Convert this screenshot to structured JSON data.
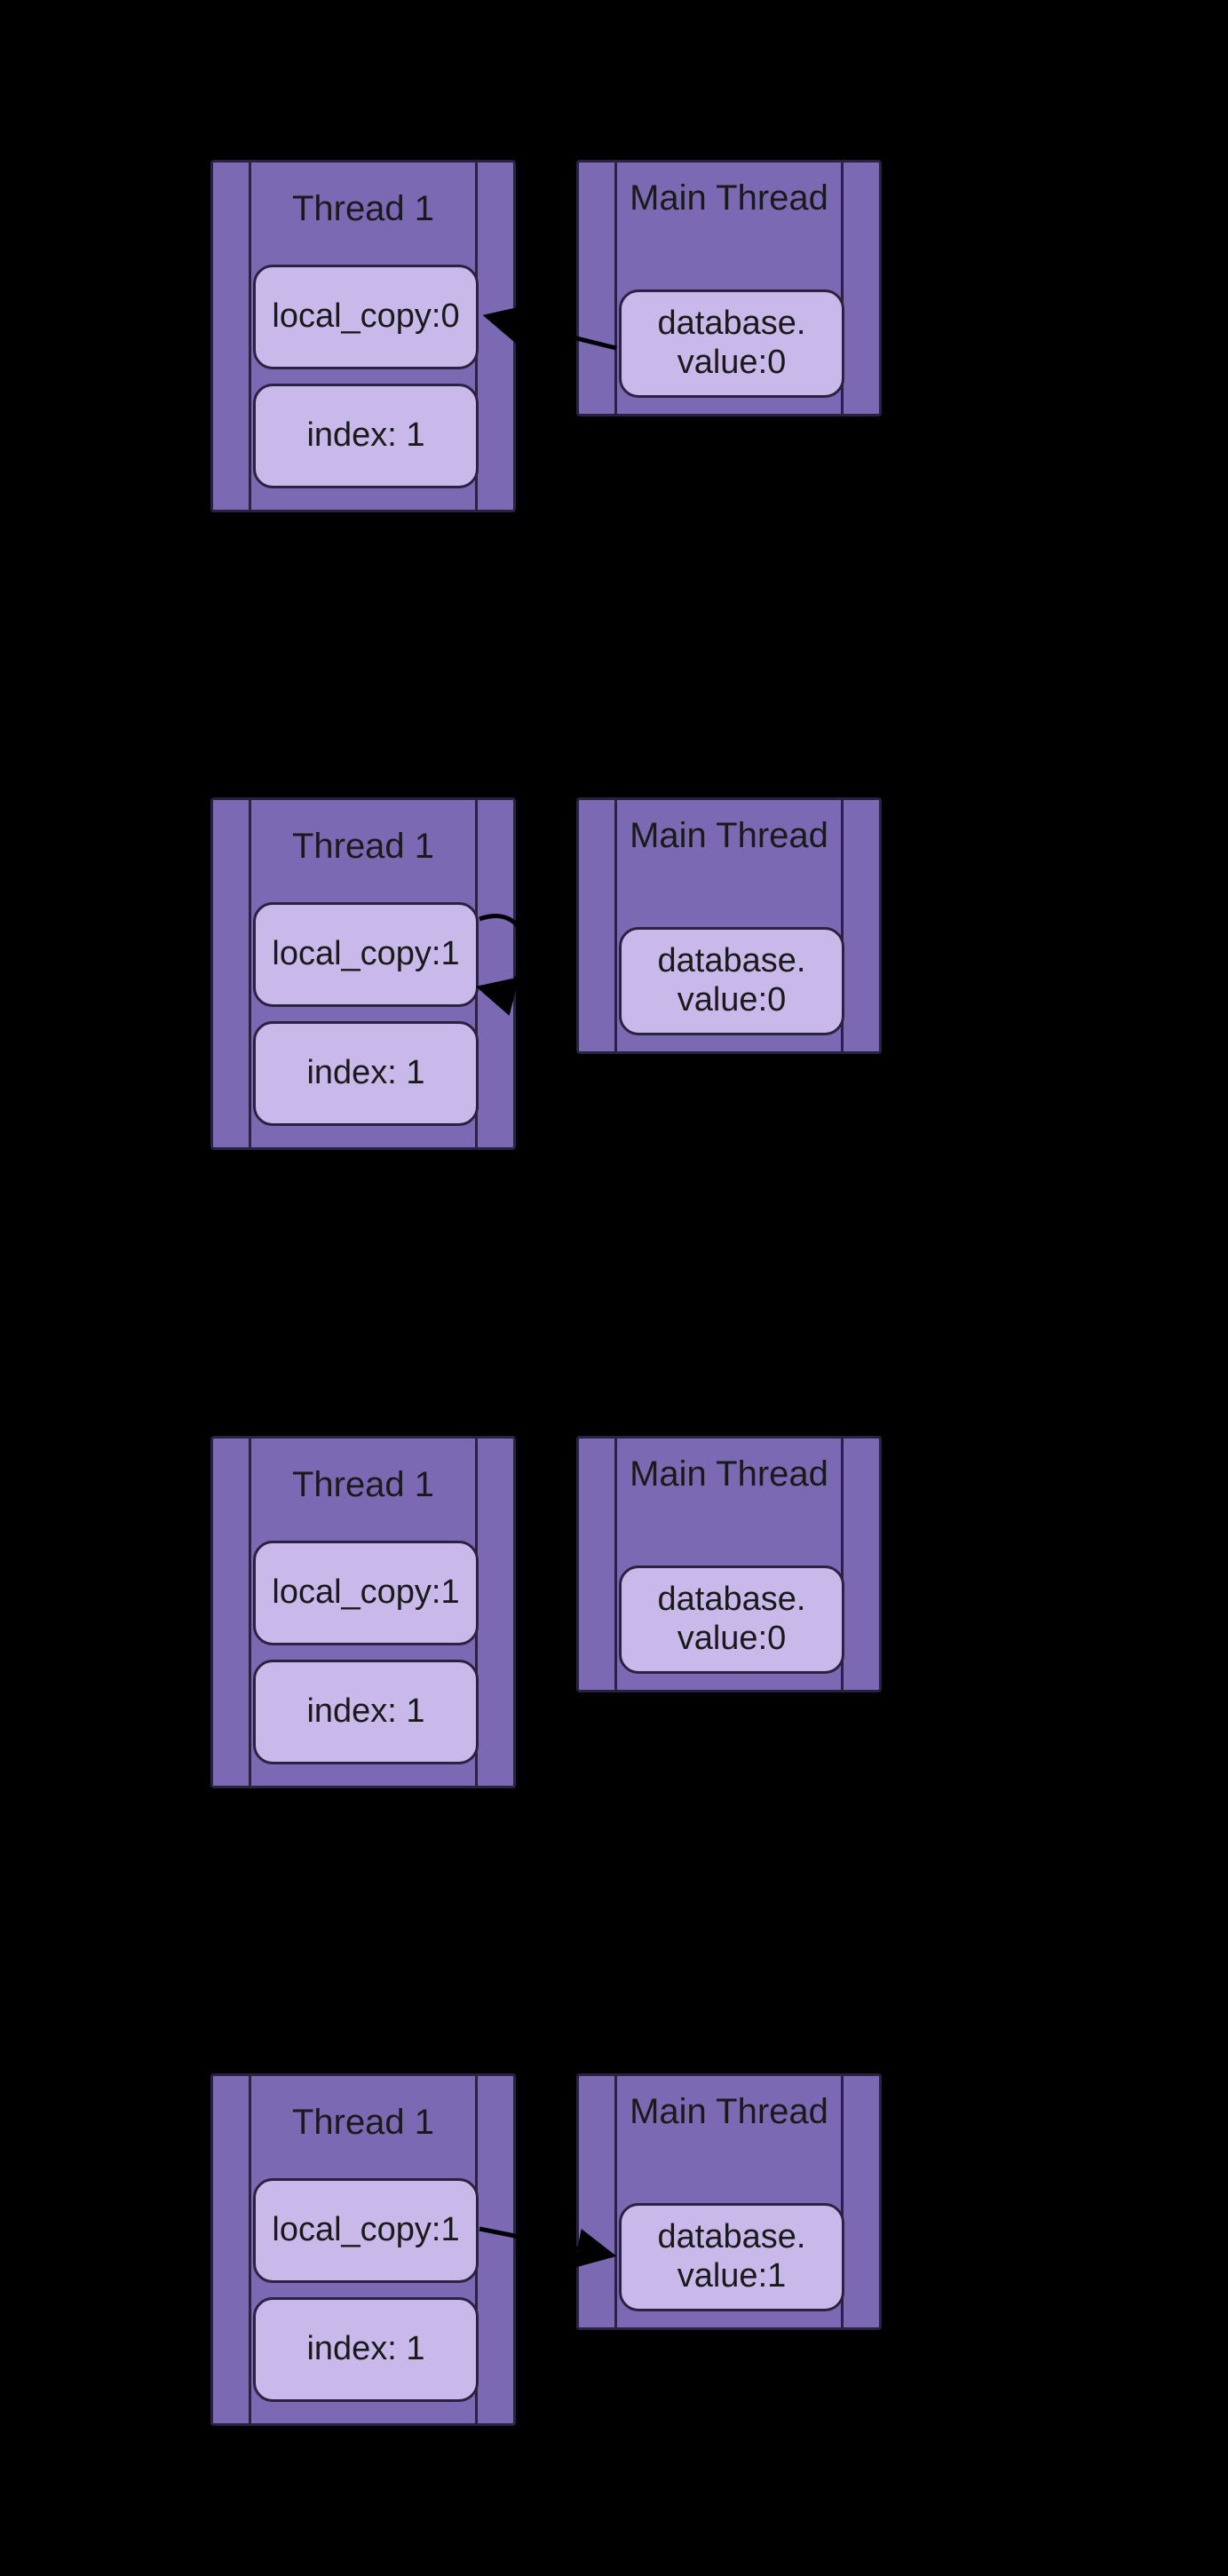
{
  "steps": [
    {
      "thread1": {
        "title": "Thread 1",
        "local_copy": "local_copy:0",
        "index": "index: 1"
      },
      "main": {
        "title": "Main Thread",
        "db": "database.\nvalue:0"
      },
      "arrow": {
        "from": "main",
        "to": "thread1"
      }
    },
    {
      "thread1": {
        "title": "Thread 1",
        "local_copy": "local_copy:1",
        "index": "index: 1"
      },
      "main": {
        "title": "Main Thread",
        "db": "database.\nvalue:0"
      },
      "arrow": {
        "self": "thread1"
      }
    },
    {
      "thread1": {
        "title": "Thread 1",
        "local_copy": "local_copy:1",
        "index": "index: 1"
      },
      "main": {
        "title": "Main Thread",
        "db": "database.\nvalue:0"
      },
      "arrow": null
    },
    {
      "thread1": {
        "title": "Thread 1",
        "local_copy": "local_copy:1",
        "index": "index: 1"
      },
      "main": {
        "title": "Main Thread",
        "db": "database.\nvalue:1"
      },
      "arrow": {
        "from": "thread1",
        "to": "main"
      }
    }
  ],
  "colors": {
    "box_bg": "#7b6ab3",
    "value_bg": "#c9b8ea",
    "border": "#2a2240"
  },
  "layout_note": "Four vertical snapshots showing Thread 1 reading database.value, incrementing local_copy, idle, then writing back."
}
